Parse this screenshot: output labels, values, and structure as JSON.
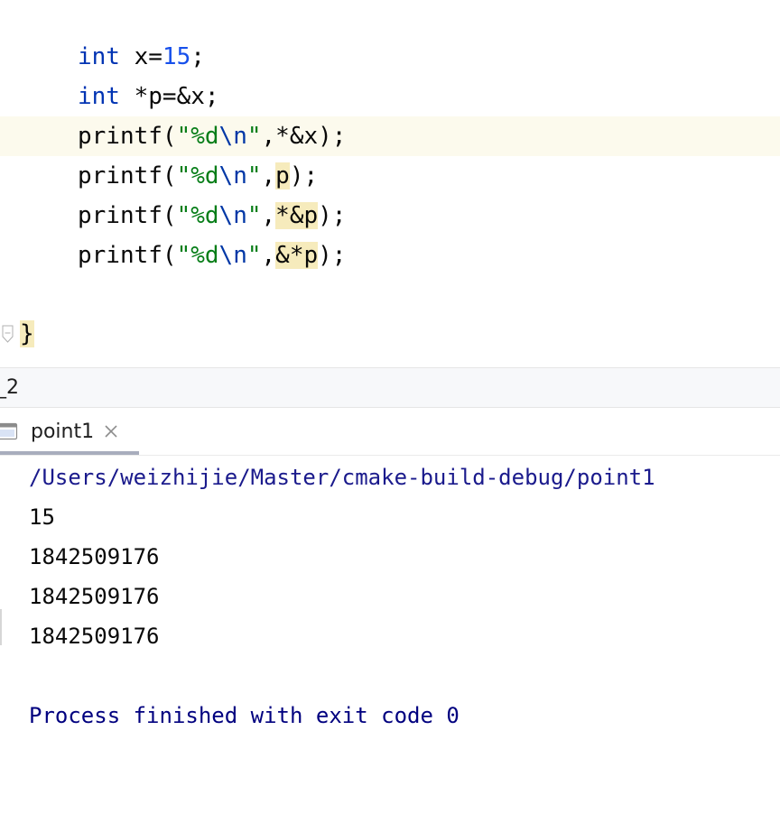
{
  "editor": {
    "lines": [
      {
        "kw": "int",
        "rest": " x=",
        "num": "15",
        "end": ";"
      },
      {
        "kw": "int",
        "rest": " *p=&x;"
      },
      {
        "fn": "printf(",
        "str_open": "\"%d",
        "esc": "\\n",
        "str_close": "\"",
        "arg": ",*&x);"
      },
      {
        "fn": "printf(",
        "str_open": "\"%d",
        "esc": "\\n",
        "str_close": "\"",
        "comma": ",",
        "arg_hl": "p",
        "tail": ");"
      },
      {
        "fn": "printf(",
        "str_open": "\"%d",
        "esc": "\\n",
        "str_close": "\"",
        "comma": ",",
        "arg_hl": "*&p",
        "tail": ");"
      },
      {
        "fn": "printf(",
        "str_open": "\"%d",
        "esc": "\\n",
        "str_close": "\"",
        "comma": ",",
        "arg_hl": "&*p",
        "tail": ");"
      }
    ],
    "closing_brace": "}",
    "colors": {
      "keyword": "#0033b3",
      "number": "#1750eb",
      "string": "#067d17",
      "escape": "#0037a6",
      "highlight": "#f6ebbc",
      "current_line": "#fcfaed"
    }
  },
  "tool_window": {
    "title": "_2"
  },
  "tabs": [
    {
      "label": "point1",
      "close": "×"
    }
  ],
  "console": {
    "path": "/Users/weizhijie/Master/cmake-build-debug/point1",
    "output": [
      "15",
      "1842509176",
      "1842509176",
      "1842509176"
    ],
    "finished": "Process finished with exit code 0"
  }
}
